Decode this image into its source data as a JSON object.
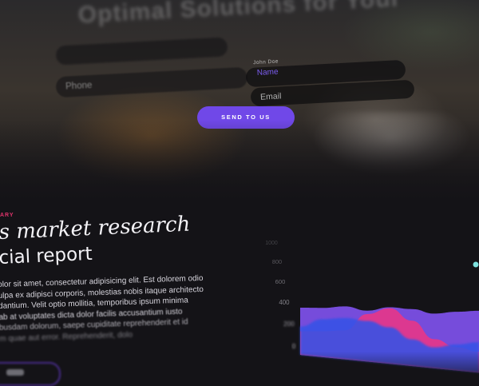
{
  "hero": {
    "title": "Optimal Solutions for Your",
    "subtitle": "",
    "form": {
      "left_top_field": "",
      "phone_placeholder": "Phone",
      "name_label": "John Doe",
      "name_value": "Name",
      "email_placeholder": "Email",
      "send_label": "SEND TO US"
    }
  },
  "section": {
    "eyebrow": "ARY",
    "heading_line1": "s market research",
    "heading_line2": "cial report",
    "body_lines": [
      "olor sit amet, consectetur adipisicing elit. Est dolorem odio",
      "ulpa ex adipisci corporis, molestias nobis itaque architecto",
      "dantium. Velit optio mollitia, temporibus ipsum minima",
      "ab at voluptates dicta dolor facilis accusantium iusto",
      "busdam dolorum, saepe cupiditate reprehenderit et id",
      "m quae aut error. Reprehenderit, dolo"
    ],
    "button_label": ""
  },
  "colors": {
    "accent_purple": "#7048e8",
    "accent_pink": "#e0336b",
    "series_violet": "#7b4fe6",
    "series_pink": "#e5368a",
    "series_blue": "#3652e6"
  },
  "chart_data": {
    "type": "area",
    "title": "",
    "xlabel": "",
    "ylabel": "",
    "ylim": [
      0,
      1000
    ],
    "yticks": [
      0,
      200,
      400,
      600,
      800,
      1000
    ],
    "x": [
      0,
      1,
      2,
      3,
      4,
      5,
      6,
      7,
      8
    ],
    "series": [
      {
        "name": "",
        "color": "#7b4fe6",
        "values": [
          600,
          610,
          640,
          600,
          650,
          640,
          600,
          630,
          650
        ]
      },
      {
        "name": "",
        "color": "#e5368a",
        "values": [
          300,
          320,
          350,
          560,
          640,
          510,
          320,
          250,
          220
        ]
      },
      {
        "name": "",
        "color": "#3652e6",
        "values": [
          360,
          470,
          500,
          480,
          420,
          300,
          230,
          280,
          320
        ]
      }
    ]
  }
}
